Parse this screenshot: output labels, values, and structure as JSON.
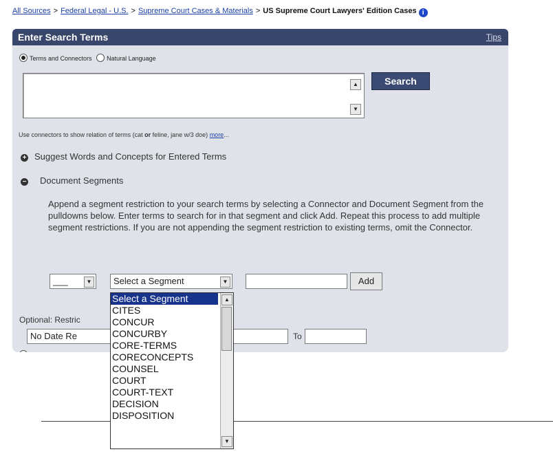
{
  "breadcrumb": {
    "items": [
      "All Sources",
      "Federal Legal - U.S.",
      "Supreme Court Cases & Materials"
    ],
    "separator": ">",
    "current": "US Supreme Court Lawyers' Edition Cases",
    "info_icon": "info-icon"
  },
  "panel": {
    "title": "Enter Search Terms",
    "tips_label": "Tips"
  },
  "search_mode": {
    "terms_and_connectors": "Terms and Connectors",
    "natural_language": "Natural Language",
    "selected": "terms_and_connectors"
  },
  "search_box": {
    "value": ""
  },
  "search_button": "Search",
  "connector_help": {
    "text": "Use connectors to show relation of terms (cat",
    "or_word": "or",
    "text2": "feline, jane w/3 doe)",
    "more_link": "more",
    "ellipsis": "..."
  },
  "suggest_words": {
    "label": "Suggest Words and Concepts for Entered Terms",
    "icon": "plus-circle-icon"
  },
  "document_segments": {
    "label": "Document Segments",
    "icon": "minus-circle-icon",
    "instructions": "Append a segment restriction to your search terms by selecting a Connector and Document Segment from the pulldowns below.  Enter terms to search for in that segment and click Add.  Repeat this process to add multiple segment restrictions.  If you are not appending the segment restriction to existing terms, omit the Connector.",
    "connector_value": "___",
    "segment_value": "Select a Segment",
    "add_button": "Add"
  },
  "optional_restrict": {
    "label": "Optional: Restric"
  },
  "date_restriction": {
    "value": "No Date Re",
    "to_label": "To"
  },
  "segment_dropdown": {
    "selected": "Select a Segment",
    "options": [
      "CITES",
      "CONCUR",
      "CONCURBY",
      "CORE-TERMS",
      "CORECONCEPTS",
      "COUNSEL",
      "COURT",
      "COURT-TEXT",
      "DECISION",
      "DISPOSITION"
    ]
  },
  "colors": {
    "panel_header": "#38466b",
    "panel_bg": "#dfe3e9",
    "link": "#1a3fa8",
    "dropdown_highlight": "#17338c"
  }
}
